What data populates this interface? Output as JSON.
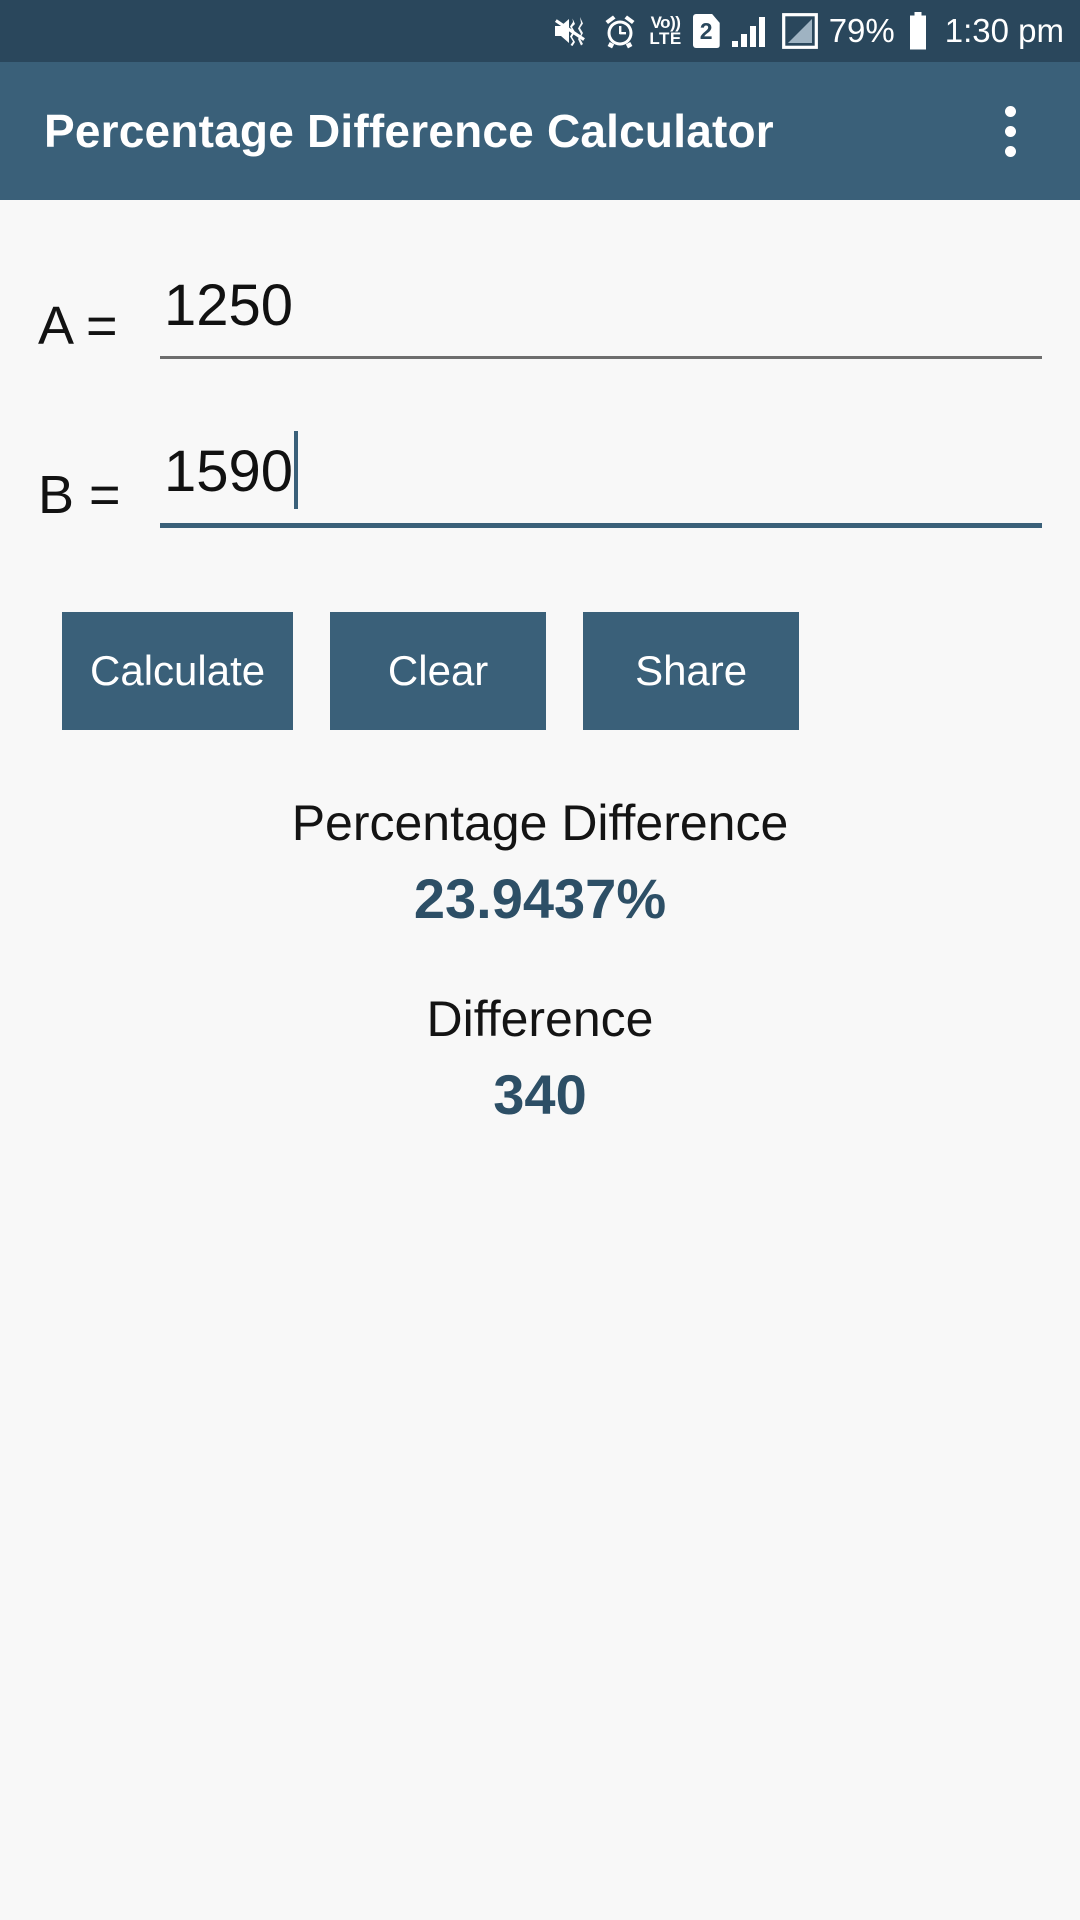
{
  "status_bar": {
    "icons": [
      {
        "name": "mute-vibrate-icon",
        "label": "mute-vibrate"
      },
      {
        "name": "alarm-icon",
        "label": "alarm"
      },
      {
        "name": "volte-icon",
        "label_top": "Vo))",
        "label_bottom": "LTE"
      },
      {
        "name": "sim-2-icon",
        "label": "2"
      },
      {
        "name": "signal-bars-icon",
        "label": "signal"
      },
      {
        "name": "second-signal-icon",
        "label": "signal-2"
      }
    ],
    "battery_percent": "79%",
    "battery_icon": "battery-icon",
    "time": "1:30 pm"
  },
  "app_bar": {
    "title": "Percentage Difference Calculator",
    "overflow_icon": "more-vertical-icon"
  },
  "form": {
    "field_a": {
      "label": "A =",
      "value": "1250",
      "placeholder": "",
      "focused": false
    },
    "field_b": {
      "label": "B =",
      "value": "1590",
      "placeholder": "",
      "focused": true
    }
  },
  "buttons": {
    "calculate": "Calculate",
    "clear": "Clear",
    "share": "Share"
  },
  "results": {
    "percentage_difference": {
      "label": "Percentage Difference",
      "value": "23.9437%"
    },
    "difference": {
      "label": "Difference",
      "value": "340"
    }
  },
  "colors": {
    "status_bar": "#2a475c",
    "app_bar": "#3a6079",
    "button": "#3a6079",
    "accent_text": "#2d4f66",
    "background": "#f8f8f8",
    "underline": "#6e6e6e"
  }
}
